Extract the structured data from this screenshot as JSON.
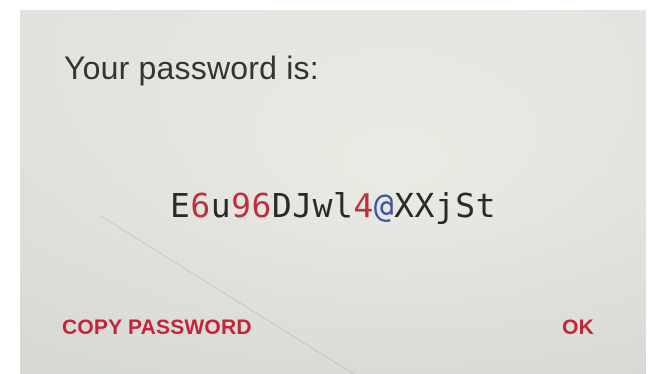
{
  "dialog": {
    "title": "Your password is:",
    "password": "E6u96DJwl4@XXjSt",
    "buttons": {
      "copy_label": "COPY PASSWORD",
      "ok_label": "OK"
    }
  },
  "colors": {
    "letter": "#222222",
    "digit": "#c0283a",
    "symbol": "#3a4fa6",
    "accent": "#c8233a",
    "background": "#e6e8e1"
  }
}
